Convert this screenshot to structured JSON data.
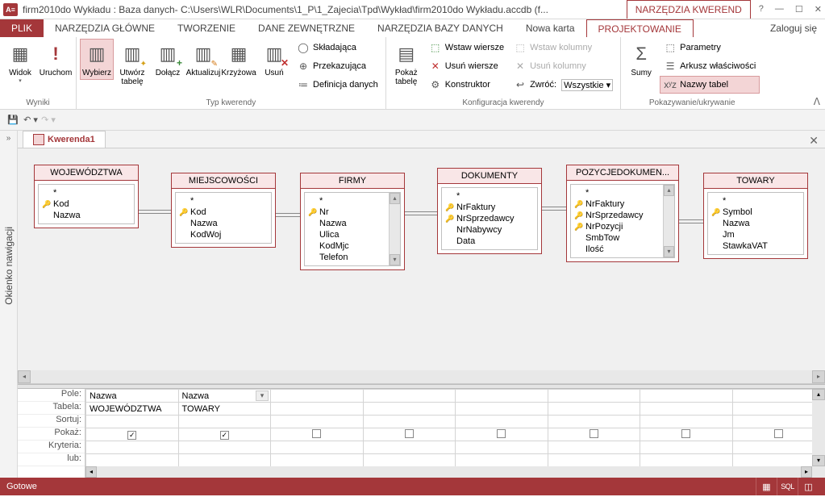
{
  "title": "firm2010do Wykładu : Baza danych- C:\\Users\\WLR\\Documents\\1_P\\1_Zajecia\\Tpd\\Wykład\\firm2010do Wykładu.accdb (f...",
  "context_tab": "NARZĘDZIA KWEREND",
  "tabs": {
    "file": "PLIK",
    "home": "NARZĘDZIA GŁÓWNE",
    "create": "TWORZENIE",
    "external": "DANE ZEWNĘTRZNE",
    "dbtools": "NARZĘDZIA BAZY DANYCH",
    "newtab": "Nowa karta",
    "design": "PROJEKTOWANIE"
  },
  "login": "Zaloguj się",
  "ribbon": {
    "results": {
      "label": "Wyniki",
      "view": "Widok",
      "run": "Uruchom"
    },
    "qtype": {
      "label": "Typ kwerendy",
      "select": "Wybierz",
      "maketable": "Utwórz\ntabelę",
      "append": "Dołącz",
      "update": "Aktualizuj",
      "crosstab": "Krzyżowa",
      "delete": "Usuń",
      "union": "Składająca",
      "passthrough": "Przekazująca",
      "datadef": "Definicja danych"
    },
    "setup": {
      "label": "Konfiguracja kwerendy",
      "showtable": "Pokaż\ntabelę",
      "insrows": "Wstaw wiersze",
      "delrows": "Usuń wiersze",
      "builder": "Konstruktor",
      "inscols": "Wstaw kolumny",
      "delcols": "Usuń kolumny",
      "return": "Zwróć:",
      "return_val": "Wszystkie"
    },
    "showhide": {
      "label": "Pokazywanie/ukrywanie",
      "totals": "Sumy",
      "params": "Parametry",
      "propsheet": "Arkusz właściwości",
      "tablenames": "Nazwy tabel"
    }
  },
  "nav_label": "Okienko nawigacji",
  "doc_tab": "Kwerenda1",
  "tables": {
    "woj": {
      "title": "WOJEWÓDZTWA",
      "star": "*",
      "f1": "Kod",
      "f2": "Nazwa"
    },
    "miejsc": {
      "title": "MIEJSCOWOŚCI",
      "star": "*",
      "f1": "Kod",
      "f2": "Nazwa",
      "f3": "KodWoj"
    },
    "firmy": {
      "title": "FIRMY",
      "star": "*",
      "f1": "Nr",
      "f2": "Nazwa",
      "f3": "Ulica",
      "f4": "KodMjc",
      "f5": "Telefon"
    },
    "dok": {
      "title": "DOKUMENTY",
      "star": "*",
      "f1": "NrFaktury",
      "f2": "NrSprzedawcy",
      "f3": "NrNabywcy",
      "f4": "Data"
    },
    "poz": {
      "title": "POZYCJEDOKUMEN...",
      "star": "*",
      "f1": "NrFaktury",
      "f2": "NrSprzedawcy",
      "f3": "NrPozycji",
      "f4": "SmbTow",
      "f5": "Ilość"
    },
    "tow": {
      "title": "TOWARY",
      "star": "*",
      "f1": "Symbol",
      "f2": "Nazwa",
      "f3": "Jm",
      "f4": "StawkaVAT"
    }
  },
  "qbe": {
    "rows": {
      "pole": "Pole:",
      "tabela": "Tabela:",
      "sortuj": "Sortuj:",
      "pokaz": "Pokaż:",
      "kryteria": "Kryteria:",
      "lub": "lub:"
    },
    "c1": {
      "pole": "Nazwa",
      "tabela": "WOJEWÓDZTWA"
    },
    "c2": {
      "pole": "Nazwa",
      "tabela": "TOWARY"
    }
  },
  "status": "Gotowe",
  "views_sql": "SQL"
}
